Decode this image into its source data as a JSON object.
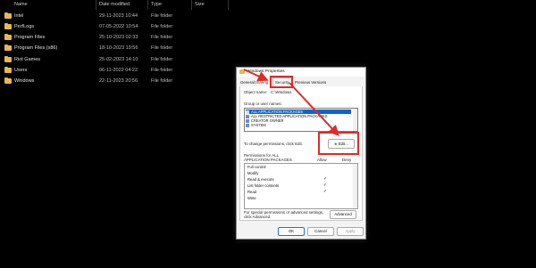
{
  "explorer": {
    "columns": {
      "name": "Name",
      "date": "Date modified",
      "type": "Type",
      "size": "Size"
    },
    "rows": [
      {
        "name": "Intel",
        "date": "29-11-2023 10:44",
        "type": "File folder"
      },
      {
        "name": "PerfLogs",
        "date": "07-05-2022 10:54",
        "type": "File folder"
      },
      {
        "name": "Program Files",
        "date": "25-10-2023 02:33",
        "type": "File folder"
      },
      {
        "name": "Program Files (x86)",
        "date": "18-10-2023 19:56",
        "type": "File folder"
      },
      {
        "name": "Riot Games",
        "date": "25-02-2023 14:10",
        "type": "File folder"
      },
      {
        "name": "Users",
        "date": "06-11-2022 04:22",
        "type": "File folder"
      },
      {
        "name": "Windows",
        "date": "22-11-2023 20:56",
        "type": "File folder"
      }
    ]
  },
  "dialog": {
    "title": "Windows Properties",
    "tabs": [
      "General",
      "Sharing",
      "Security",
      "Previous Versions"
    ],
    "object_name_label": "Object name:",
    "object_name_value": "C:\\Windows",
    "group_label": "Group or user names:",
    "groups": [
      "ALL APPLICATION PACKAGES",
      "ALL RESTRICTED APPLICATION PACKAGES",
      "CREATOR OWNER",
      "SYSTEM"
    ],
    "change_text": "To change permissions, click Edit.",
    "edit_label": "Edit...",
    "perm_header_1": "Permissions for ALL",
    "perm_header_2": "APPLICATION PACKAGES",
    "allow_label": "Allow",
    "deny_label": "Deny",
    "permissions": [
      {
        "name": "Full control",
        "allow": ""
      },
      {
        "name": "Modify",
        "allow": ""
      },
      {
        "name": "Read & execute",
        "allow": "✓"
      },
      {
        "name": "List folder contents",
        "allow": "✓"
      },
      {
        "name": "Read",
        "allow": "✓"
      },
      {
        "name": "Write",
        "allow": ""
      }
    ],
    "special_text_1": "For special permissions or advanced settings,",
    "special_text_2": "click Advanced.",
    "advanced_label": "Advanced",
    "ok_label": "OK",
    "cancel_label": "Cancel",
    "apply_label": "Apply"
  },
  "annotation_color": "#e02a2a",
  "folder_color": "#e8b84a",
  "selection_color": "#0a64d0"
}
